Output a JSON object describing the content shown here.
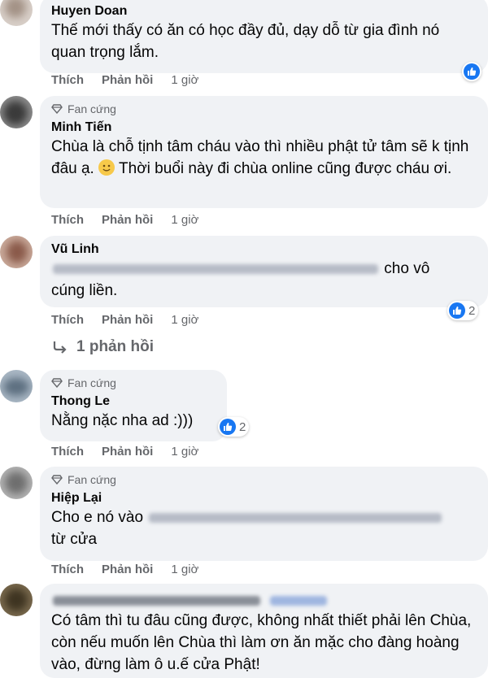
{
  "labels": {
    "like": "Thích",
    "reply": "Phản hồi",
    "fan_badge": "Fan cứng"
  },
  "comments": [
    {
      "author": "Huyen Doan",
      "text": "Thế mới thấy có ăn có học đầy đủ, dạy dỗ từ gia đình nó quan trọng lắm.",
      "time": "1 giờ"
    },
    {
      "author": "Minh Tiến",
      "text_a": "Chùa là chỗ tịnh tâm cháu vào thì nhiều phật tử tâm sẽ k tịnh đâu ạ.",
      "text_b": "Thời buổi này đi chùa online cũng được cháu ơi.",
      "emoji": "smiling-face",
      "time": "1 giờ"
    },
    {
      "author": "Vũ Linh",
      "text_a": "cho vô",
      "text_b": "cúng liền.",
      "time": "1 giờ",
      "reactions": "2",
      "replies": "1 phản hồi"
    },
    {
      "author": "Thong Le",
      "text": "Nằng nặc nha ad :)))",
      "time": "1 giờ",
      "reactions": "2"
    },
    {
      "author": "Hiệp Lại",
      "text_a": "Cho e nó vào",
      "text_b": "từ cửa",
      "time": "1 giờ"
    },
    {
      "text": "Có tâm thì tu đâu cũng được, không nhất thiết phải lên Chùa, còn nếu muốn lên Chùa thì làm ơn ăn mặc cho đàng hoàng vào, đừng làm ô u.ế cửa Phật!"
    }
  ],
  "colors": {
    "bubble": "#f0f2f5",
    "meta": "#65676b",
    "like_blue": "#1877f2"
  }
}
